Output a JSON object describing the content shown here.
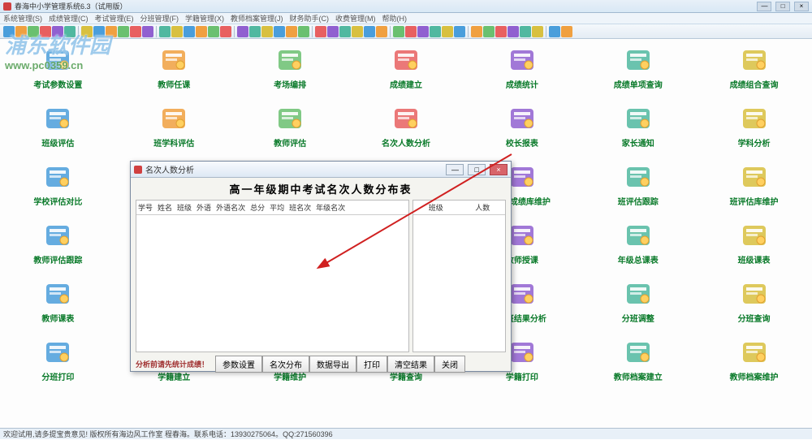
{
  "window": {
    "title": "春海中小学管理系统6.3（试用版）",
    "min": "—",
    "max": "□",
    "close": "×"
  },
  "menubar": [
    "系统管理(S)",
    "成绩管理(C)",
    "考试管理(E)",
    "分班管理(F)",
    "学籍管理(X)",
    "教师档案管理(J)",
    "财务助手(C)",
    "收费管理(M)",
    "帮助(H)"
  ],
  "watermark": {
    "text": "浦东软件园",
    "url": "www.pc0359.cn"
  },
  "icons": [
    {
      "label": "考试参数设置",
      "name": "exam-params-icon"
    },
    {
      "label": "教师任课",
      "name": "teacher-assign-icon"
    },
    {
      "label": "考场编排",
      "name": "exam-room-icon"
    },
    {
      "label": "成绩建立",
      "name": "score-create-icon"
    },
    {
      "label": "成绩统计",
      "name": "score-stats-icon"
    },
    {
      "label": "成绩单项查询",
      "name": "score-single-query-icon"
    },
    {
      "label": "成绩组合查询",
      "name": "score-combo-query-icon"
    },
    {
      "label": "班级评估",
      "name": "class-eval-icon"
    },
    {
      "label": "班学科评估",
      "name": "class-subject-eval-icon"
    },
    {
      "label": "教师评估",
      "name": "teacher-eval-icon"
    },
    {
      "label": "名次人数分析",
      "name": "rank-count-icon"
    },
    {
      "label": "校长报表",
      "name": "principal-report-icon"
    },
    {
      "label": "家长通知",
      "name": "parent-notice-icon"
    },
    {
      "label": "学科分析",
      "name": "subject-analysis-icon"
    },
    {
      "label": "学校评估对比",
      "name": "school-compare-icon"
    },
    {
      "label": "",
      "name": "blank"
    },
    {
      "label": "",
      "name": "blank"
    },
    {
      "label": "",
      "name": "blank"
    },
    {
      "label": "学生成绩库维护",
      "name": "student-db-icon"
    },
    {
      "label": "班评估跟踪",
      "name": "class-track-icon"
    },
    {
      "label": "班评估库维护",
      "name": "class-eval-db-icon"
    },
    {
      "label": "教师评估跟踪",
      "name": "teacher-track-icon"
    },
    {
      "label": "",
      "name": "blank"
    },
    {
      "label": "",
      "name": "blank"
    },
    {
      "label": "",
      "name": "blank"
    },
    {
      "label": "教师授课",
      "name": "teacher-teach-icon"
    },
    {
      "label": "年级总课表",
      "name": "grade-schedule-icon"
    },
    {
      "label": "班级课表",
      "name": "class-schedule-icon"
    },
    {
      "label": "教师课表",
      "name": "teacher-schedule-icon"
    },
    {
      "label": "",
      "name": "blank"
    },
    {
      "label": "",
      "name": "blank"
    },
    {
      "label": "",
      "name": "blank"
    },
    {
      "label": "分班结果分析",
      "name": "divide-result-icon"
    },
    {
      "label": "分班调整",
      "name": "divide-adjust-icon"
    },
    {
      "label": "分班查询",
      "name": "divide-query-icon"
    },
    {
      "label": "分班打印",
      "name": "divide-print-icon"
    },
    {
      "label": "学籍建立",
      "name": "register-create-icon"
    },
    {
      "label": "学籍维护",
      "name": "register-maintain-icon"
    },
    {
      "label": "学籍查询",
      "name": "register-query-icon"
    },
    {
      "label": "学籍打印",
      "name": "register-print-icon"
    },
    {
      "label": "教师档案建立",
      "name": "teacher-file-create-icon"
    },
    {
      "label": "教师档案维护",
      "name": "teacher-file-maintain-icon"
    }
  ],
  "dialog": {
    "title": "名次人数分析",
    "heading": "高一年级期中考试名次人数分布表",
    "left_cols": [
      "学号",
      "姓名",
      "班级",
      "外语",
      "外语名次",
      "总分",
      "平均",
      "班名次",
      "年级名次"
    ],
    "right_cols": [
      "班级",
      "人数"
    ],
    "hint": "分析前请先统计成绩！",
    "buttons": [
      "参数设置",
      "名次分布",
      "数据导出",
      "打印",
      "清空结果",
      "关闭"
    ],
    "min": "—",
    "max": "□",
    "close": "×"
  },
  "statusbar": "欢迎试用,请多提宝贵意见! 版权所有海边风工作室 程春海。联系电话：13930275064。QQ:271560396",
  "icon_colors": [
    "#4a9edb",
    "#f0a040",
    "#6ac070",
    "#e86060",
    "#9060d0",
    "#50b8a0",
    "#d8c040"
  ]
}
